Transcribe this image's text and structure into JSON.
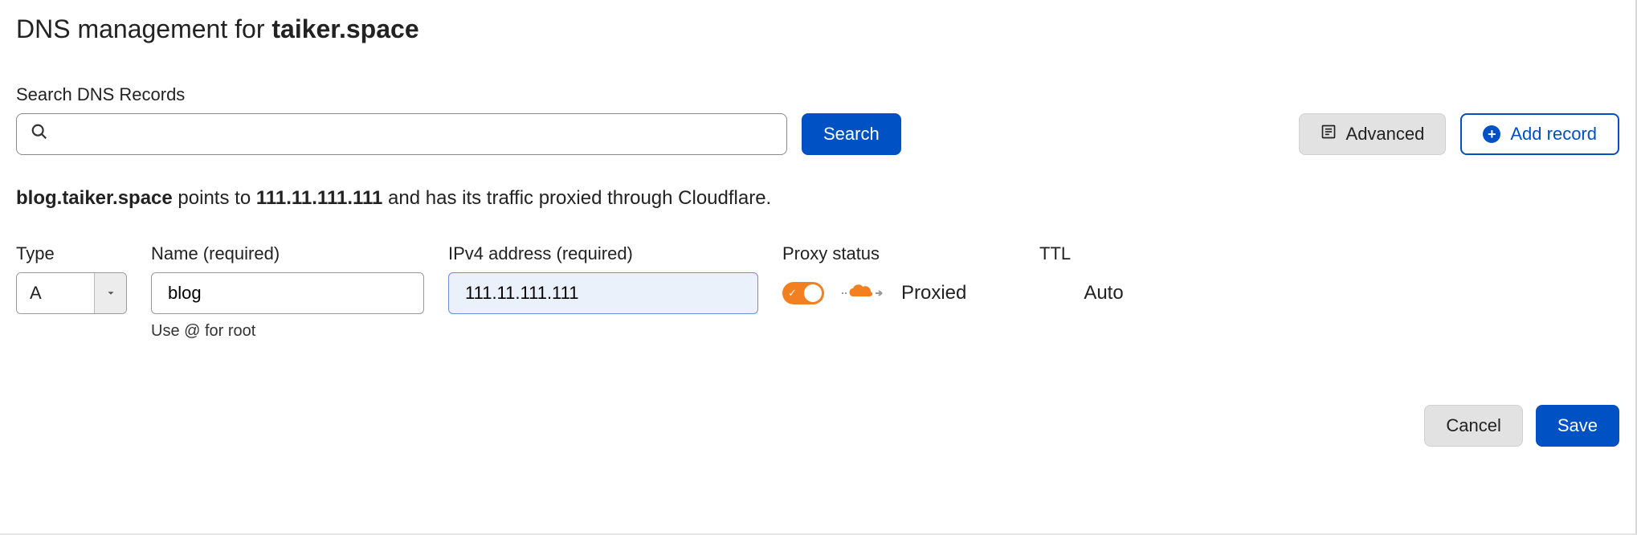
{
  "header": {
    "prefix": "DNS management for ",
    "domain": "taiker.space"
  },
  "search": {
    "label": "Search DNS Records",
    "value": "",
    "search_button": "Search",
    "advanced_button": "Advanced",
    "add_record_button": "Add record"
  },
  "description": {
    "host": "blog.taiker.space",
    "mid1": " points to ",
    "ip": "111.11.111.111",
    "mid2": " and has its traffic proxied through Cloudflare."
  },
  "form": {
    "type": {
      "label": "Type",
      "value": "A"
    },
    "name": {
      "label": "Name (required)",
      "value": "blog",
      "hint": "Use @ for root"
    },
    "ip": {
      "label": "IPv4 address (required)",
      "value": "111.11.111.111"
    },
    "proxy": {
      "label": "Proxy status",
      "value": "Proxied",
      "enabled": true
    },
    "ttl": {
      "label": "TTL",
      "value": "Auto"
    }
  },
  "footer": {
    "cancel": "Cancel",
    "save": "Save"
  }
}
